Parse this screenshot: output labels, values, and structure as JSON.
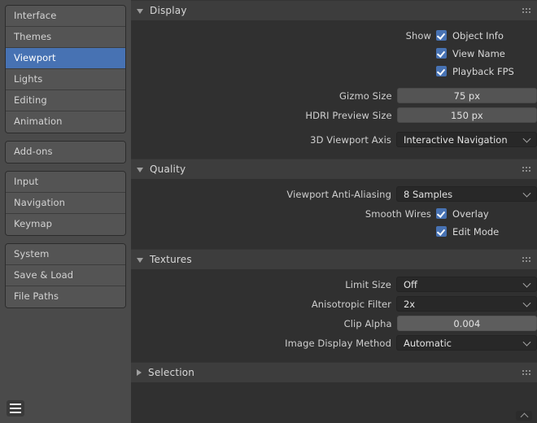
{
  "sidebar": {
    "groups": [
      {
        "items": [
          {
            "label": "Interface",
            "active": false
          },
          {
            "label": "Themes",
            "active": false
          },
          {
            "label": "Viewport",
            "active": true
          },
          {
            "label": "Lights",
            "active": false
          },
          {
            "label": "Editing",
            "active": false
          },
          {
            "label": "Animation",
            "active": false
          }
        ]
      },
      {
        "items": [
          {
            "label": "Add-ons",
            "active": false
          }
        ]
      },
      {
        "items": [
          {
            "label": "Input",
            "active": false
          },
          {
            "label": "Navigation",
            "active": false
          },
          {
            "label": "Keymap",
            "active": false
          }
        ]
      },
      {
        "items": [
          {
            "label": "System",
            "active": false
          },
          {
            "label": "Save & Load",
            "active": false
          },
          {
            "label": "File Paths",
            "active": false
          }
        ]
      }
    ],
    "menu_icon": "hamburger-icon"
  },
  "sections": [
    {
      "title": "Display",
      "expanded": true,
      "rows": [
        {
          "kind": "checkbox",
          "label": "Show",
          "text": "Object Info",
          "checked": true
        },
        {
          "kind": "checkbox",
          "label": "",
          "text": "View Name",
          "checked": true
        },
        {
          "kind": "checkbox",
          "label": "",
          "text": "Playback FPS",
          "checked": true
        },
        {
          "kind": "numeric",
          "label": "Gizmo Size",
          "value": "75 px",
          "spaced": true
        },
        {
          "kind": "numeric",
          "label": "HDRI Preview Size",
          "value": "150 px"
        },
        {
          "kind": "select",
          "label": "3D Viewport Axis",
          "value": "Interactive Navigation",
          "spaced": true
        }
      ]
    },
    {
      "title": "Quality",
      "expanded": true,
      "rows": [
        {
          "kind": "select",
          "label": "Viewport Anti-Aliasing",
          "value": "8 Samples"
        },
        {
          "kind": "checkbox",
          "label": "Smooth Wires",
          "text": "Overlay",
          "checked": true
        },
        {
          "kind": "checkbox",
          "label": "",
          "text": "Edit Mode",
          "checked": true
        }
      ]
    },
    {
      "title": "Textures",
      "expanded": true,
      "rows": [
        {
          "kind": "select",
          "label": "Limit Size",
          "value": "Off"
        },
        {
          "kind": "select",
          "label": "Anisotropic Filter",
          "value": "2x"
        },
        {
          "kind": "slider",
          "label": "Clip Alpha",
          "value": "0.004"
        },
        {
          "kind": "select",
          "label": "Image Display Method",
          "value": "Automatic"
        }
      ]
    },
    {
      "title": "Selection",
      "expanded": false,
      "rows": []
    }
  ],
  "colors": {
    "accent_blue": "#4772b3",
    "panel_bg": "#303030",
    "sidebar_bg": "#4a4a4a",
    "header_bg": "#3d3d3d",
    "field_dark": "#282828",
    "field_numeric": "#545454",
    "slider_fill": "#5d5d5d"
  },
  "corner_widget": "chevron-up-icon"
}
